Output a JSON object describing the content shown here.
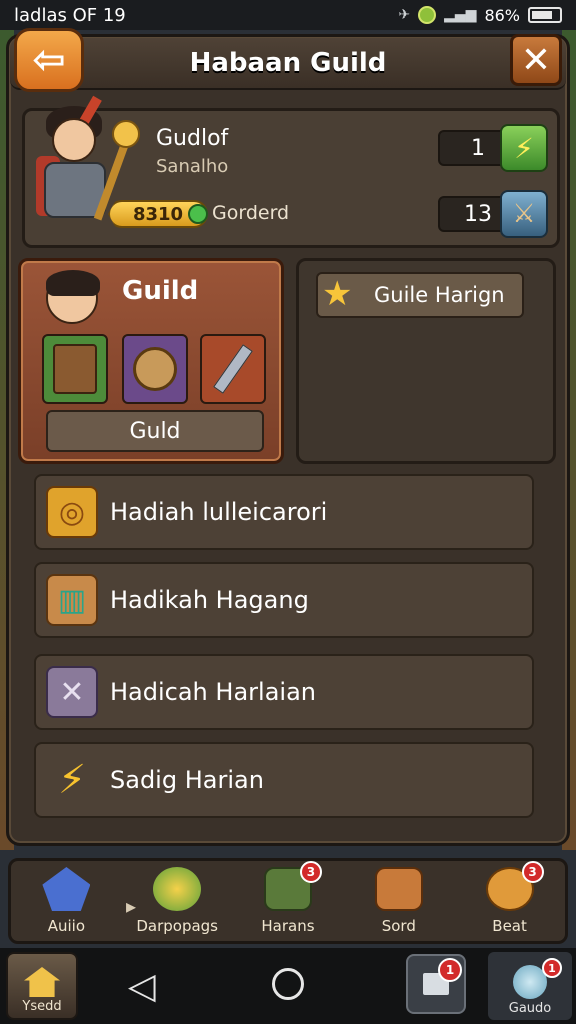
{
  "status_bar": {
    "time": "ladlas OF 19",
    "battery": "86%"
  },
  "header": {
    "title": "Habaan Guild"
  },
  "profile": {
    "name": "Gudlof",
    "subtitle": "Sanalho",
    "stat_top": "1",
    "stat_bottom": "13",
    "gold_amount": "8310",
    "gold_label": "Gorderd"
  },
  "guild_card": {
    "title": "Guild",
    "button_label": "Guld"
  },
  "right_panel": {
    "button_label": "Guile Harign"
  },
  "list_items": [
    {
      "label": "Hadiah lulleicarori",
      "icon": "coin-swirl-icon"
    },
    {
      "label": "Hadikah Hagang",
      "icon": "treasure-box-icon"
    },
    {
      "label": "Hadicah Harlaian",
      "icon": "crossed-swords-icon"
    },
    {
      "label": "Sadig Harian",
      "icon": "lightning-icon"
    }
  ],
  "bottom_nav": [
    {
      "label": "Auiio",
      "badge": ""
    },
    {
      "label": "Darpopags",
      "badge": ""
    },
    {
      "label": "Harans",
      "badge": "3"
    },
    {
      "label": "Sord",
      "badge": ""
    },
    {
      "label": "Beat",
      "badge": "3"
    }
  ],
  "system_nav": {
    "home_label": "Ysedd",
    "recent_badge": "1",
    "app_label": "Gaudo",
    "app_badge": "1"
  }
}
